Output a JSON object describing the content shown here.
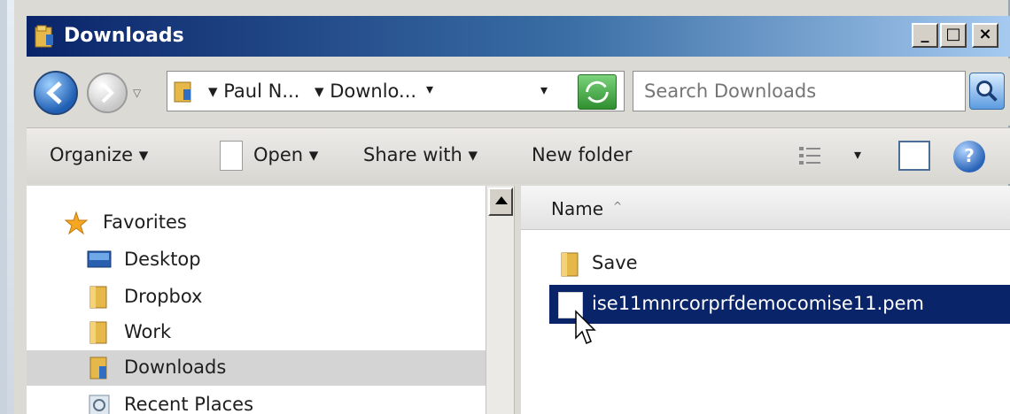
{
  "window": {
    "title": "Downloads",
    "minimize_glyph": "_",
    "maximize_glyph": "□",
    "close_glyph": "×"
  },
  "address": {
    "crumb_1": "▾ Paul N...",
    "crumb_2": "▾ Downlo...",
    "crumb_dropdown": "▾",
    "address_dropdown": "▾",
    "search_placeholder": "Search Downloads"
  },
  "toolbar": {
    "organize": "Organize ▾",
    "open": "Open ▾",
    "share_with": "Share with ▾",
    "new_folder": "New folder",
    "view_dropdown": "▾",
    "help_glyph": "?"
  },
  "navigation": {
    "favorites": "Favorites",
    "items": [
      {
        "label": "Desktop"
      },
      {
        "label": "Dropbox"
      },
      {
        "label": "Work"
      },
      {
        "label": "Downloads"
      },
      {
        "label": "Recent Places"
      }
    ]
  },
  "content": {
    "column_name": "Name",
    "sort_glyph": "^",
    "files": [
      {
        "name": "Save",
        "type": "folder"
      },
      {
        "name": "ise11mnrcorprfdemocomise11.pem",
        "type": "file",
        "selected": true
      }
    ]
  },
  "colors": {
    "title_bar_start": "#0a246a",
    "title_bar_end": "#a6caf0",
    "selection": "#0a246a",
    "selected_nav": "#d4d4d4"
  },
  "icons": [
    "folder-icon",
    "back-arrow-icon",
    "forward-arrow-icon",
    "refresh-icon",
    "search-icon",
    "document-icon",
    "view-options-icon",
    "preview-pane-icon",
    "help-icon",
    "star-icon",
    "desktop-icon",
    "recent-places-icon",
    "mouse-cursor-icon"
  ]
}
